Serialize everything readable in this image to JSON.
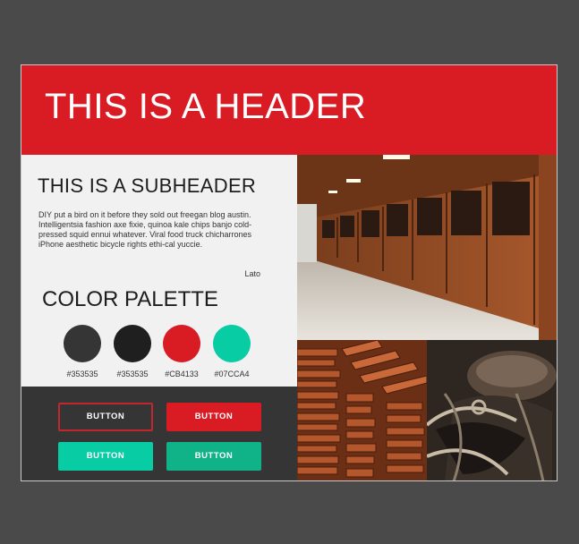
{
  "header": {
    "title": "THIS IS A HEADER"
  },
  "content": {
    "subheader": "THIS IS A SUBHEADER",
    "body": "DIY put a bird on it before they sold out freegan blog austin. Intelligentsia fashion axe fixie, quinoa kale chips banjo cold-pressed squid ennui whatever. Viral food truck chicharrones iPhone aesthetic bicycle rights ethi-cal yuccie.",
    "font_name": "Lato"
  },
  "palette": {
    "title": "COLOR PALETTE",
    "swatches": [
      {
        "label": "#353535",
        "color": "#353535"
      },
      {
        "label": "#353535",
        "color": "#1f1f1f"
      },
      {
        "label": "#CB4133",
        "color": "#d91b24"
      },
      {
        "label": "#07CCA4",
        "color": "#07cca4"
      }
    ]
  },
  "buttons": [
    {
      "label": "BUTTON",
      "style": "outline-red"
    },
    {
      "label": "BUTTON",
      "style": "red"
    },
    {
      "label": "BUTTON",
      "style": "teal"
    },
    {
      "label": "BUTTON",
      "style": "dark-teal"
    }
  ],
  "images": [
    {
      "icon": "stable-barn-photo"
    },
    {
      "icon": "wood-planks-photo"
    },
    {
      "icon": "saddle-photo"
    }
  ]
}
